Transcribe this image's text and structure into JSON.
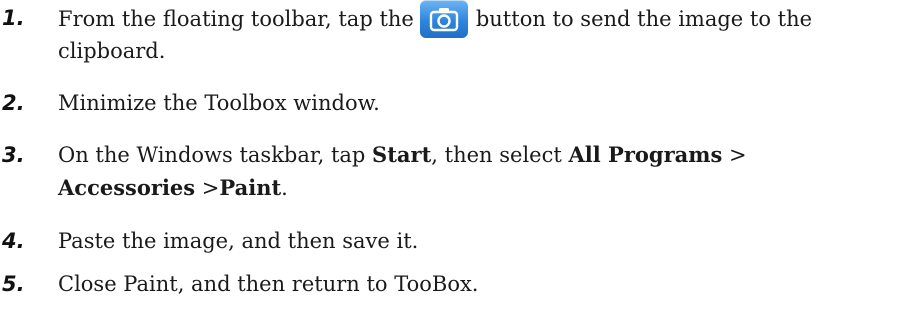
{
  "steps": [
    {
      "number": "1.",
      "before": "From the floating toolbar, tap the",
      "icon": "camera-icon",
      "after": "button to send the image to the",
      "line2": "clipboard."
    },
    {
      "number": "2.",
      "text": "Minimize the Toolbox window."
    },
    {
      "number": "3.",
      "a": "On the Windows taskbar, tap ",
      "start": "Start",
      "b": ", then select ",
      "all_programs": "All Programs",
      "sep1": " >",
      "accessories": "Accessories",
      "sep2": " >",
      "paint": "Paint",
      "end": "."
    },
    {
      "number": "4.",
      "text": "Paste the image, and then save it."
    },
    {
      "number": "5.",
      "text": "Close Paint, and then return to TooBox."
    }
  ],
  "colors": {
    "button_blue": "#2e86dd"
  }
}
